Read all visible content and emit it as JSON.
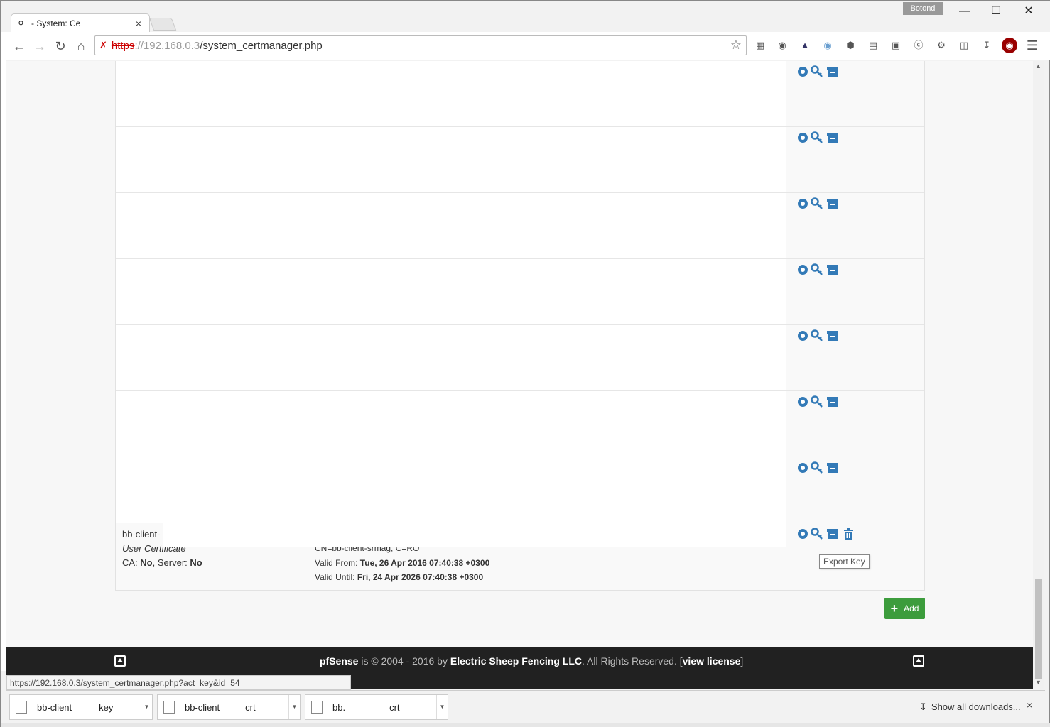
{
  "browser": {
    "tab_title": "- System: Ce",
    "tab_close": "×",
    "profile_name": "Botond",
    "url_scheme": "https",
    "url_host": "://192.168.0.3",
    "url_path": "/system_certmanager.php",
    "status_url": "https://192.168.0.3/system_certmanager.php?act=key&id=54"
  },
  "certificates": {
    "last": {
      "name": "bb-client-",
      "type": "User Certificate",
      "ca_label": "CA: ",
      "ca_value": "No",
      "server_label": ", Server: ",
      "server_value": "No",
      "dn": "CN=bb-client-srmag, C=RO",
      "valid_from_label": "Valid From: ",
      "valid_from": "Tue, 26 Apr 2016 07:40:38 +0300",
      "valid_until_label": "Valid Until: ",
      "valid_until": "Fri, 24 Apr 2026 07:40:38 +0300"
    },
    "tooltip": "Export Key"
  },
  "add_button": {
    "label": "Add"
  },
  "footer": {
    "brand": "pfSense",
    "copyright": " is © 2004 - 2016 by ",
    "company": "Electric Sheep Fencing LLC",
    "rights": ". All Rights Reserved. [",
    "license": "view license",
    "close_bracket": "]"
  },
  "downloads": {
    "items": [
      {
        "prefix": "bb-client",
        "suffix": "key"
      },
      {
        "prefix": "bb-client",
        "suffix": "crt"
      },
      {
        "prefix": "bb.",
        "suffix": "crt"
      }
    ],
    "show_all": "Show all downloads...",
    "close": "×"
  },
  "colors": {
    "accent_blue": "#337ab7",
    "add_green": "#3c9c3c",
    "footer_bg": "#212121"
  }
}
